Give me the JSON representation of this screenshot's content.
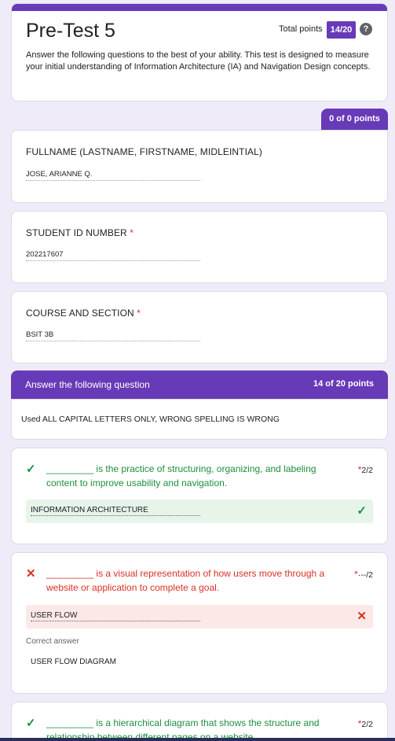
{
  "header": {
    "title": "Pre-Test 5",
    "total_points_label": "Total points",
    "score": "14/20",
    "help_icon": "?",
    "description": "Answer the following questions to the best of your ability. This test is designed to measure your initial understanding of Information Architecture (IA) and Navigation Design concepts."
  },
  "section1": {
    "points": "0 of 0 points",
    "questions": [
      {
        "title": "FULLNAME (LASTNAME, FIRSTNAME, MIDLEINTIAL)",
        "required": "",
        "answer": "JOSE, ARIANNE Q."
      },
      {
        "title": "STUDENT ID NUMBER",
        "required": "*",
        "answer": "202217607"
      },
      {
        "title": "COURSE AND SECTION",
        "required": "*",
        "answer": "BSIT 3B"
      }
    ]
  },
  "section2": {
    "title": "Answer the following question",
    "points": "14 of 20 points",
    "description": "Used ALL CAPITAL LETTERS ONLY, WRONG SPELLING IS WRONG",
    "questions": [
      {
        "status": "correct",
        "status_icon": "✓",
        "text": "_________ is the practice of structuring, organizing, and labeling content to improve usability and navigation.",
        "required": "*",
        "points": "2/2",
        "answer": "INFORMATION ARCHITECTURE",
        "answer_mark": "✓"
      },
      {
        "status": "wrong",
        "status_icon": "✕",
        "text": "_________ is a visual representation of how users move through a website or application to complete a goal.",
        "required": "*",
        "points": "·--/2",
        "answer": "USER FLOW",
        "answer_mark": "✕",
        "correct_answer_label": "Correct answer",
        "correct_answer": "USER FLOW DIAGRAM"
      },
      {
        "status": "correct",
        "status_icon": "✓",
        "text": "_________ is a hierarchical diagram that shows the structure and relationship between different pages on a website.",
        "required": "*",
        "points": "2/2"
      }
    ]
  },
  "colors": {
    "accent": "#673ab7",
    "background": "#efebf8",
    "correct": "#1e8e3e",
    "correct_bg": "#e6f4ea",
    "wrong": "#d93025",
    "wrong_bg": "#fce8e6"
  }
}
